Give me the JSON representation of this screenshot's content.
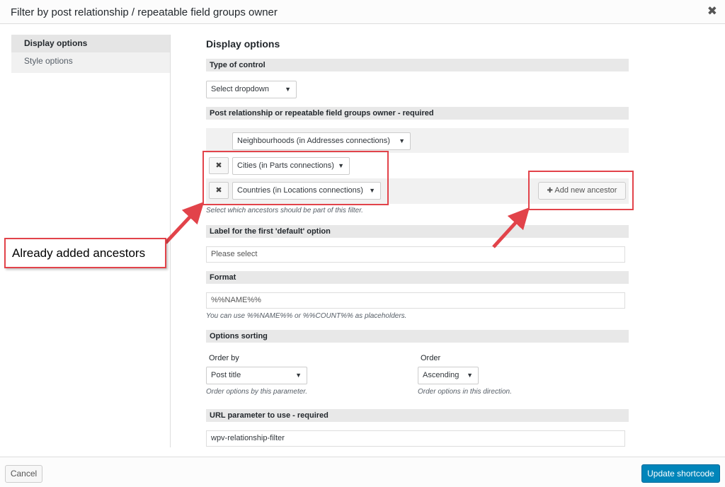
{
  "dialog": {
    "title": "Filter by post relationship / repeatable field groups owner",
    "close_glyph": "✖"
  },
  "sidebar": {
    "items": [
      {
        "label": "Display options"
      },
      {
        "label": "Style options"
      }
    ]
  },
  "main": {
    "heading": "Display options",
    "type_of_control": {
      "section_label": "Type of control",
      "selected": "Select dropdown"
    },
    "relationship": {
      "section_label": "Post relationship or repeatable field groups owner - required",
      "rows": [
        {
          "selected": "Neighbourhoods (in Addresses connections)"
        },
        {
          "selected": "Cities (in Parts connections)",
          "remove_glyph": "✖"
        },
        {
          "selected": "Countries (in Locations connections)",
          "remove_glyph": "✖"
        }
      ],
      "add_button": "Add new ancestor",
      "add_glyph": "✚",
      "hint": "Select which ancestors should be part of this filter."
    },
    "default_label": {
      "section_label": "Label for the first 'default' option",
      "placeholder": "Please select"
    },
    "format": {
      "section_label": "Format",
      "value": "%%NAME%%",
      "hint": "You can use %%NAME%% or %%COUNT%% as placeholders."
    },
    "sorting": {
      "section_label": "Options sorting",
      "order_by": {
        "label": "Order by",
        "selected": "Post title",
        "hint": "Order options by this parameter."
      },
      "order": {
        "label": "Order",
        "selected": "Ascending",
        "hint": "Order options in this direction."
      }
    },
    "url_param": {
      "section_label": "URL parameter to use - required",
      "value": "wpv-relationship-filter"
    }
  },
  "annotation": {
    "callout_text": "Already added ancestors",
    "accent_color": "#e2434a"
  },
  "footer": {
    "cancel": "Cancel",
    "submit": "Update shortcode",
    "primary_color": "#0085ba"
  },
  "caret_glyph": "▼"
}
